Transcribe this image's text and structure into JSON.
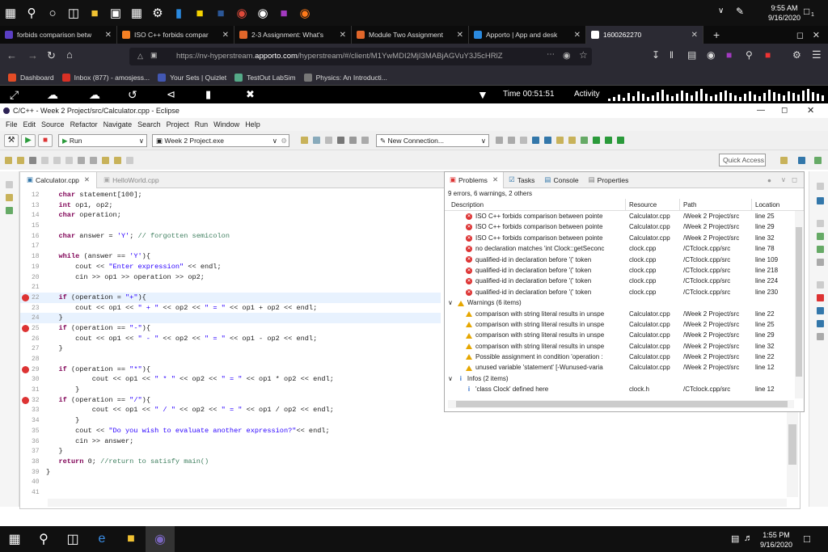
{
  "windows_top": {
    "time": "9:55 AM",
    "date": "9/16/2020",
    "badge": "1"
  },
  "browser_tabs": [
    {
      "label": "forbids comparison betw",
      "color": "#5b3fc4"
    },
    {
      "label": "ISO C++ forbids compar",
      "color": "#f48024"
    },
    {
      "label": "2-3 Assignment: What's",
      "color": "#e0662a"
    },
    {
      "label": "Module Two Assignment",
      "color": "#e0662a"
    },
    {
      "label": "Apporto | App and desk",
      "color": "#2a8ae0"
    },
    {
      "label": "1600262270",
      "color": "#ffffff",
      "active": true
    }
  ],
  "url": {
    "prefix": "https://nv-hyperstream.",
    "domain": "apporto.com",
    "rest": "/hyperstream/#/client/M1YwMDI2MjI3MABjAGVuY3J5cHRlZ"
  },
  "bookmarks": [
    {
      "label": "Dashboard",
      "color": "#e34c26"
    },
    {
      "label": "Inbox (877) - amosjess...",
      "color": "#d93025"
    },
    {
      "label": "Your Sets | Quizlet",
      "color": "#4257b2"
    },
    {
      "label": "TestOut LabSim",
      "color": "#5a8"
    },
    {
      "label": "Physics: An Introducti...",
      "color": "#777"
    }
  ],
  "apporto": {
    "timer": "Time 00:51:51",
    "activity": "Activity"
  },
  "eclipse": {
    "title": "C/C++ - Week 2 Project/src/Calculator.cpp - Eclipse",
    "menu": [
      "File",
      "Edit",
      "Source",
      "Refactor",
      "Navigate",
      "Search",
      "Project",
      "Run",
      "Window",
      "Help"
    ],
    "run_label": "Run",
    "target": "Week 2 Project.exe",
    "connection": "New Connection...",
    "quick_access": "Quick Access"
  },
  "editor": {
    "tabs": [
      "Calculator.cpp",
      "HelloWorld.cpp"
    ],
    "lines": [
      {
        "n": "12",
        "t": "   char statement[100];"
      },
      {
        "n": "13",
        "t": "   int op1, op2;"
      },
      {
        "n": "14",
        "t": "   char operation;"
      },
      {
        "n": "15",
        "t": ""
      },
      {
        "n": "16",
        "t": "   char answer = 'Y'; // forgotten semicolon"
      },
      {
        "n": "17",
        "t": ""
      },
      {
        "n": "18",
        "t": "   while (answer == 'Y'){"
      },
      {
        "n": "19",
        "t": "       cout << \"Enter expression\" << endl;"
      },
      {
        "n": "20",
        "t": "       cin >> op1 >> operation >> op2;"
      },
      {
        "n": "21",
        "t": ""
      },
      {
        "n": "22",
        "t": "   if (operation = \"+\"){",
        "err": true,
        "hl": true
      },
      {
        "n": "23",
        "t": "       cout << op1 << \" + \" << op2 << \" = \" << op1 + op2 << endl;"
      },
      {
        "n": "24",
        "t": "   }",
        "hl": true
      },
      {
        "n": "25",
        "t": "   if (operation == \"-\"){",
        "err": true
      },
      {
        "n": "26",
        "t": "       cout << op1 << \" - \" << op2 << \" = \" << op1 - op2 << endl;"
      },
      {
        "n": "27",
        "t": "   }"
      },
      {
        "n": "28",
        "t": ""
      },
      {
        "n": "29",
        "t": "   if (operation == \"*\"){",
        "err": true
      },
      {
        "n": "30",
        "t": "           cout << op1 << \" * \" << op2 << \" = \" << op1 * op2 << endl;"
      },
      {
        "n": "31",
        "t": "       }"
      },
      {
        "n": "32",
        "t": "   if (operation == \"/\"){",
        "err": true
      },
      {
        "n": "33",
        "t": "           cout << op1 << \" / \" << op2 << \" = \" << op1 / op2 << endl;"
      },
      {
        "n": "34",
        "t": "       }"
      },
      {
        "n": "35",
        "t": "       cout << \"Do you wish to evaluate another expression?\"<< endl;"
      },
      {
        "n": "36",
        "t": "       cin >> answer;"
      },
      {
        "n": "37",
        "t": "   }"
      },
      {
        "n": "38",
        "t": "   return 0; //return to satisfy main()"
      },
      {
        "n": "39",
        "t": "}"
      },
      {
        "n": "40",
        "t": ""
      },
      {
        "n": "41",
        "t": ""
      }
    ]
  },
  "problems": {
    "tabs": [
      "Problems",
      "Tasks",
      "Console",
      "Properties"
    ],
    "summary": "9 errors, 6 warnings, 2 others",
    "headers": [
      "Description",
      "Resource",
      "Path",
      "Location"
    ],
    "rows": [
      {
        "kind": "error",
        "d": "ISO C++ forbids comparison between pointe",
        "r": "Calculator.cpp",
        "p": "/Week 2 Project/src",
        "l": "line 25"
      },
      {
        "kind": "error",
        "d": "ISO C++ forbids comparison between pointe",
        "r": "Calculator.cpp",
        "p": "/Week 2 Project/src",
        "l": "line 29"
      },
      {
        "kind": "error",
        "d": "ISO C++ forbids comparison between pointe",
        "r": "Calculator.cpp",
        "p": "/Week 2 Project/src",
        "l": "line 32"
      },
      {
        "kind": "error",
        "d": "no declaration matches 'int Clock::getSeconc",
        "r": "clock.cpp",
        "p": "/CTclock.cpp/src",
        "l": "line 78"
      },
      {
        "kind": "error",
        "d": "qualified-id in declaration before '(' token",
        "r": "clock.cpp",
        "p": "/CTclock.cpp/src",
        "l": "line 109"
      },
      {
        "kind": "error",
        "d": "qualified-id in declaration before '(' token",
        "r": "clock.cpp",
        "p": "/CTclock.cpp/src",
        "l": "line 218"
      },
      {
        "kind": "error",
        "d": "qualified-id in declaration before '(' token",
        "r": "clock.cpp",
        "p": "/CTclock.cpp/src",
        "l": "line 224"
      },
      {
        "kind": "error",
        "d": "qualified-id in declaration before '(' token",
        "r": "clock.cpp",
        "p": "/CTclock.cpp/src",
        "l": "line 230"
      },
      {
        "kind": "group",
        "d": "Warnings (6 items)",
        "r": "",
        "p": "",
        "l": ""
      },
      {
        "kind": "warn",
        "d": "comparison with string literal results in unspe",
        "r": "Calculator.cpp",
        "p": "/Week 2 Project/src",
        "l": "line 22"
      },
      {
        "kind": "warn",
        "d": "comparison with string literal results in unspe",
        "r": "Calculator.cpp",
        "p": "/Week 2 Project/src",
        "l": "line 25"
      },
      {
        "kind": "warn",
        "d": "comparison with string literal results in unspe",
        "r": "Calculator.cpp",
        "p": "/Week 2 Project/src",
        "l": "line 29"
      },
      {
        "kind": "warn",
        "d": "comparison with string literal results in unspe",
        "r": "Calculator.cpp",
        "p": "/Week 2 Project/src",
        "l": "line 32"
      },
      {
        "kind": "warn",
        "d": "Possible assignment in condition 'operation :",
        "r": "Calculator.cpp",
        "p": "/Week 2 Project/src",
        "l": "line 22"
      },
      {
        "kind": "warn",
        "d": "unused variable 'statement' [-Wunused-varia",
        "r": "Calculator.cpp",
        "p": "/Week 2 Project/src",
        "l": "line 12"
      },
      {
        "kind": "group",
        "d": "Infos (2 items)",
        "r": "",
        "p": "",
        "l": ""
      },
      {
        "kind": "info",
        "d": "'class Clock' defined here",
        "r": "clock.h",
        "p": "/CTclock.cpp/src",
        "l": "line 12"
      }
    ]
  },
  "taskbar": {
    "time": "1:55 PM",
    "date": "9/16/2020"
  }
}
